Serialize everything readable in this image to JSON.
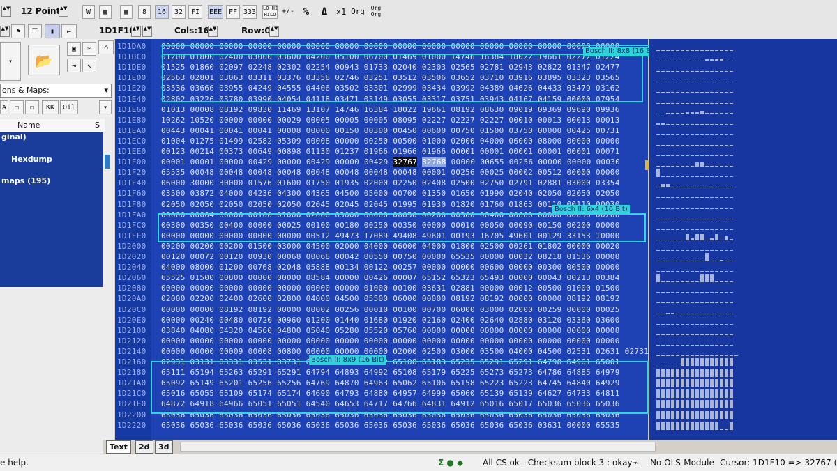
{
  "toolbar": {
    "font_size": "12 Point",
    "block_tools": [
      "8",
      "16",
      "32",
      "FI"
    ],
    "view_modes": [
      "EEE",
      "FF",
      "333"
    ],
    "lohi": "LO HI\nHILO",
    "sign": "+/-",
    "percent": "%",
    "delta": "Δ",
    "mul1": "×1",
    "org": "Org",
    "org2": "Org\nOrg"
  },
  "toolbar2": {
    "address": "1D1F10",
    "cols_label": "Cols:16",
    "row_label": "Row:0"
  },
  "left_panel": {
    "filter_label": "ons & Maps:",
    "filter_buttons": [
      "A",
      "☐",
      "☐",
      "KK",
      "Oil"
    ],
    "column_name": "Name",
    "column_s": "S",
    "items": [
      "ginal)",
      "Hexdump",
      "maps (195)"
    ]
  },
  "hex_rows": [
    {
      "addr": "1D1DA0",
      "data": "00000 00000 00000 00000 00000 00000 00000 00000 00000 00000 00000 00000 00000 00000 00000 00000"
    },
    {
      "addr": "1D1DC0",
      "data": "01200 01800 02400 03000 03600 04200 05100 06700 01469 01000 14746 16384 18022 19661 02272 01224"
    },
    {
      "addr": "1D1DE0",
      "data": "01525 01860 02097 02248 02302 02254 00943 01733 02040 02303 02565 02781 02943 02822 01347 02477"
    },
    {
      "addr": "1D1E00",
      "data": "02563 02801 03063 03311 03376 03358 02746 03251 03512 03506 03652 03710 03916 03895 03323 03565"
    },
    {
      "addr": "1D1E20",
      "data": "03536 03666 03955 04249 04555 04406 03502 03301 02999 03434 03992 04389 04626 04433 03479 03162"
    },
    {
      "addr": "1D1E40",
      "data": "02802 03226 03780 03990 04054 04118 03471 03149 03055 03317 03751 03943 04167 04159 00000 07954"
    },
    {
      "addr": "1D1E60",
      "data": "01013 00008 08192 09830 11469 13107 14746 16384 18022 19661 08192 08630 09019 09369 09690 09936"
    },
    {
      "addr": "1D1E80",
      "data": "10262 10520 00000 00000 00029 00005 00005 00005 08095 02227 02227 02227 00010 00013 00013 00013"
    },
    {
      "addr": "1D1EA0",
      "data": "00443 00041 00041 00041 00008 00000 00150 00300 00450 00600 00750 01500 03750 00000 00425 00731"
    },
    {
      "addr": "1D1EC0",
      "data": "01004 01275 01499 02582 05309 00008 00000 00250 00500 01000 02000 04000 06000 08000 00000 00000"
    },
    {
      "addr": "1D1EE0",
      "data": "00123 00214 00373 00649 00898 01130 01237 01966 01966 01966 00001 00001 00001 00001 00001 00071"
    },
    {
      "addr": "1D1F00",
      "data": "00001 00001 00000 00429 00000 00429 00000 00429 32767 32768 00000 00655 00256 00000 00000 00030"
    },
    {
      "addr": "1D1F20",
      "data": "65535 00048 00048 00048 00048 00048 00048 00048 00048 00001 00256 00025 00002 00512 00000 00000"
    },
    {
      "addr": "1D1F40",
      "data": "06000 30000 30000 01576 01600 01750 01935 02000 02250 02408 02500 02750 02791 02881 03000 03354"
    },
    {
      "addr": "1D1F60",
      "data": "03500 03872 04000 04236 04300 04365 04500 05000 00700 01350 01650 01990 02040 02050 02050 02050"
    },
    {
      "addr": "1D1F80",
      "data": "02050 02050 02050 02050 02050 02045 02045 02045 01995 01930 01820 01760 01863 00110 00110 00030"
    },
    {
      "addr": "1D1FA0",
      "data": "00000 00004 00006 00100 01000 02000 03000 00000 00050 00200 00300 00400 00600 00000 00050 00200"
    },
    {
      "addr": "1D1FC0",
      "data": "00300 00350 00400 00000 00025 00100 00180 00250 00350 00000 00010 00050 00090 00150 00200 00000"
    },
    {
      "addr": "1D1FE0",
      "data": "00000 00000 00000 00000 00000 00512 49473 17089 49408 49601 00193 16705 49601 00129 33153 10000"
    },
    {
      "addr": "1D2000",
      "data": "00200 00200 00200 01500 03000 04500 02000 04000 06000 04000 01800 02500 00261 01802 00000 00020"
    },
    {
      "addr": "1D2020",
      "data": "00120 00072 00120 00930 00068 00068 00042 00550 00750 00000 65535 00000 00032 08218 01536 00000"
    },
    {
      "addr": "1D2040",
      "data": "04000 08000 01200 00768 02048 05888 00134 00122 00257 00000 00000 00600 00000 00300 00500 00000"
    },
    {
      "addr": "1D2060",
      "data": "65525 01500 00800 00000 00000 08584 00000 00426 00007 65152 65323 65493 00000 00043 00213 00384"
    },
    {
      "addr": "1D2080",
      "data": "00000 00000 00000 00000 00000 00000 00000 01000 00100 03631 02881 00000 00012 00500 01000 01500"
    },
    {
      "addr": "1D20A0",
      "data": "02000 02200 02400 02600 02800 04000 04500 05500 06000 00000 08192 08192 00000 00000 08192 08192"
    },
    {
      "addr": "1D20C0",
      "data": "00000 00000 08192 08192 00000 00002 00256 00010 00100 00700 06000 03000 02000 00259 00000 00025"
    },
    {
      "addr": "1D20E0",
      "data": "00000 00240 00480 00720 00960 01200 01440 01680 01920 02160 02400 02640 02880 03120 03360 03600"
    },
    {
      "addr": "1D2100",
      "data": "03840 04080 04320 04560 04800 05040 05280 05520 05760 00000 00000 00000 00000 00000 00000 00000"
    },
    {
      "addr": "1D2120",
      "data": "00000 00000 00000 00000 00000 00000 00000 00000 00000 00000 00000 00000 00000 00000 00000 00000"
    },
    {
      "addr": "1D2140",
      "data": "00000 00000 00009 00008 00800 00000 00000 00000 02000 02500 03000 03500 04000 04500 02531 02631 02731"
    },
    {
      "addr": "1D2160",
      "data": "02931 03131 03331 03531 03731 64797 64902 65002 65108 65183 65235 65291 65291 64798 64901 65001"
    },
    {
      "addr": "1D2180",
      "data": "65111 65194 65263 65291 65291 64794 64893 64992 65108 65179 65225 65273 65273 64786 64885 64979"
    },
    {
      "addr": "1D21A0",
      "data": "65092 65149 65201 65256 65256 64769 64870 64963 65062 65106 65158 65223 65223 64745 64840 64929"
    },
    {
      "addr": "1D21C0",
      "data": "65016 65055 65109 65174 65174 64690 64793 64880 64957 64999 65060 65139 65139 64627 64733 64811"
    },
    {
      "addr": "1D21E0",
      "data": "64872 64918 64966 65051 65051 64540 64653 64717 64766 64831 64912 65016 65017 65036 65036 65036"
    },
    {
      "addr": "1D2200",
      "data": "65036 65036 65036 65036 65036 65036 65036 65036 65036 65036 65036 65036 65036 65036 65036 65036"
    },
    {
      "addr": "1D2220",
      "data": "65036 65036 65036 65036 65036 65036 65036 65036 65036 65036 65036 65036 65036 03631 00000 65535"
    }
  ],
  "map_labels": {
    "map1": "Bosch II: 8x8 (16 Bit)",
    "map2": "Bosch II: 6x4 (16 Bit)",
    "map3": "Bosch II: 8x9 (16 Bit)"
  },
  "tabs": [
    "Text",
    "2d",
    "3d"
  ],
  "status": {
    "help": "e help.",
    "checksum": "All CS ok - Checksum block 3 : okay",
    "ols": "No OLS-Module",
    "cursor": "Cursor: 1D1F10 => 32767 (32767"
  },
  "colors": {
    "hex_bg": "#1e41b4",
    "map_border": "#31d7e0",
    "cursor_bg": "#101010"
  }
}
